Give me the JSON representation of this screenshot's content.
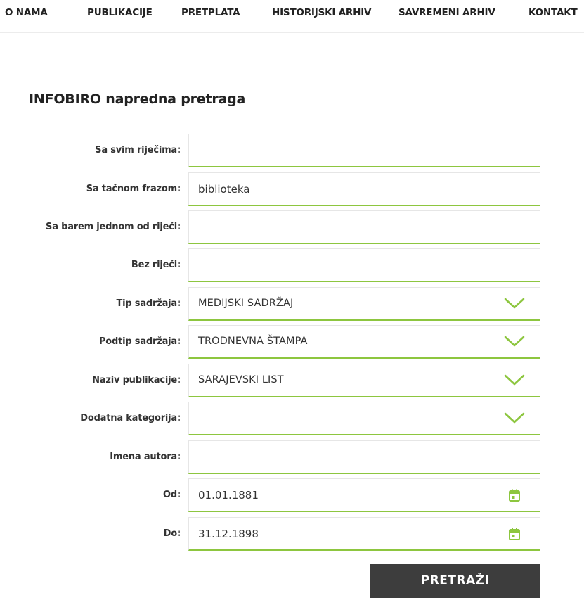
{
  "nav": {
    "items": [
      {
        "label": "O NAMA"
      },
      {
        "label": "PUBLIKACIJE"
      },
      {
        "label": "PRETPLATA"
      },
      {
        "label": "HISTORIJSKI ARHIV"
      },
      {
        "label": "SAVREMENI ARHIV"
      },
      {
        "label": "KONTAKT"
      }
    ]
  },
  "page": {
    "title": "INFOBIRO napredna pretraga"
  },
  "form": {
    "all_words": {
      "label": "Sa svim riječima:",
      "value": ""
    },
    "exact_phrase": {
      "label": "Sa tačnom frazom:",
      "value": "biblioteka"
    },
    "any_word": {
      "label": "Sa barem jednom od riječi:",
      "value": ""
    },
    "without_words": {
      "label": "Bez riječi:",
      "value": ""
    },
    "content_type": {
      "label": "Tip sadržaja:",
      "value": "MEDIJSKI SADRŽAJ",
      "icon": "chevron-down-icon"
    },
    "content_subtype": {
      "label": "Podtip sadržaja:",
      "value": "TRODNEVNA ŠTAMPA",
      "icon": "chevron-down-icon"
    },
    "publication_name": {
      "label": "Naziv publikacije:",
      "value": "SARAJEVSKI LIST",
      "icon": "chevron-down-icon"
    },
    "extra_category": {
      "label": "Dodatna kategorija:",
      "value": "",
      "icon": "chevron-down-icon"
    },
    "author_names": {
      "label": "Imena autora:",
      "value": ""
    },
    "date_from": {
      "label": "Od:",
      "value": "01.01.1881",
      "icon": "calendar-icon"
    },
    "date_to": {
      "label": "Do:",
      "value": "31.12.1898",
      "icon": "calendar-icon"
    },
    "submit_label": "PRETRAŽI"
  },
  "colors": {
    "accent": "#8dc63f",
    "button": "#3d3d3d",
    "text": "#222222"
  }
}
